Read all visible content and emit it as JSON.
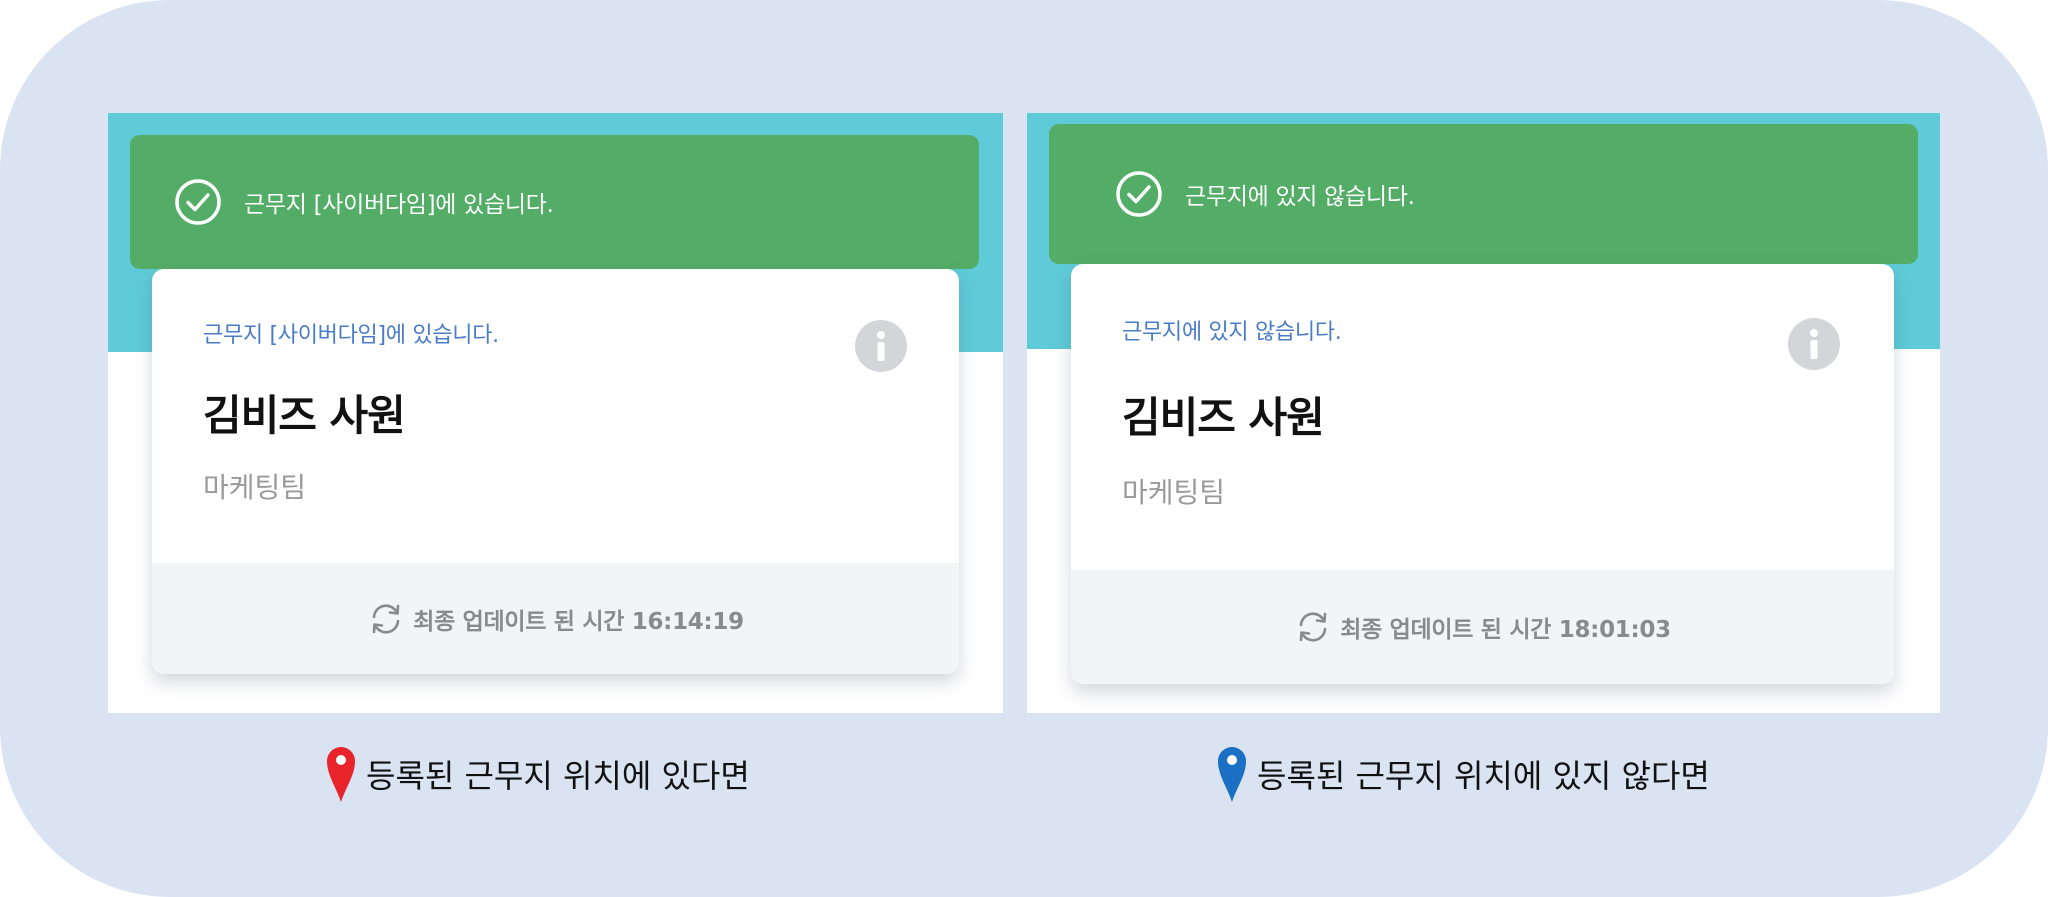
{
  "left": {
    "toast_text": "근무지 [사이버다임]에 있습니다.",
    "card": {
      "status": "근무지 [사이버다임]에 있습니다.",
      "name": "김비즈 사원",
      "team": "마케팅팀",
      "updated": "최종 업데이트 된 시간 16:14:19"
    },
    "caption": "등록된 근무지 위치에 있다면",
    "pin_color": "#e8232a"
  },
  "right": {
    "toast_text": "근무지에 있지 않습니다.",
    "card": {
      "status": "근무지에 있지 않습니다.",
      "name": "김비즈 사원",
      "team": "마케팅팀",
      "updated": "최종 업데이트 된 시간 18:01:03"
    },
    "caption": "등록된 근무지 위치에 있지 않다면",
    "pin_color": "#1b6fc4"
  },
  "colors": {
    "background": "#dae3f2",
    "header_band": "#5fcbd8",
    "toast_green": "#54ad66",
    "status_blue": "#4a7cc9"
  },
  "icons": [
    "check-circle-icon",
    "info-icon",
    "sync-icon",
    "location-pin-icon"
  ]
}
